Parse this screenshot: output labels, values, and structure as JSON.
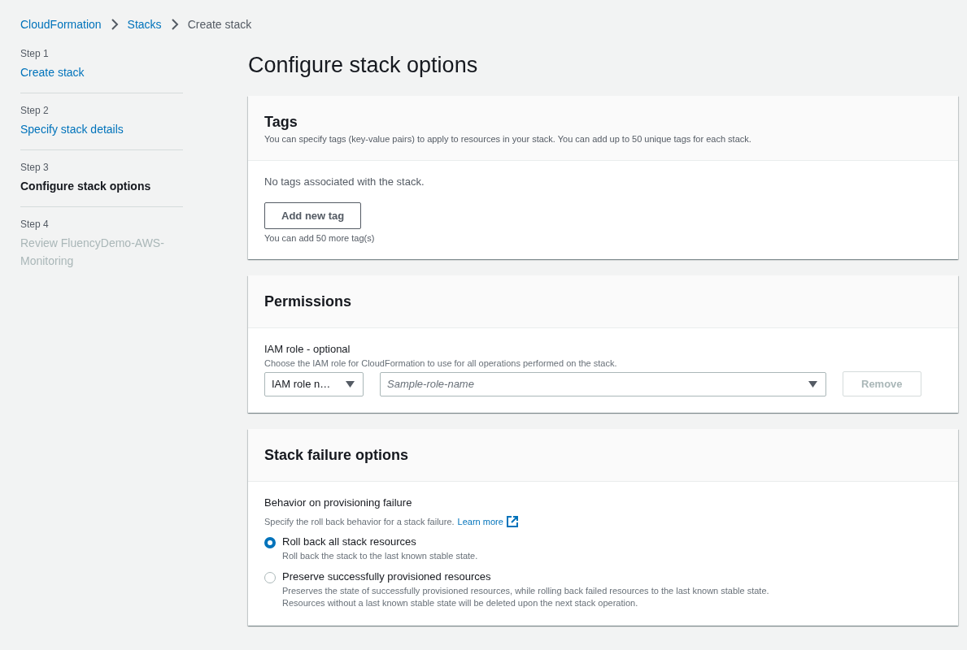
{
  "breadcrumbs": [
    {
      "label": "CloudFormation",
      "link": true
    },
    {
      "label": "Stacks",
      "link": true
    },
    {
      "label": "Create stack",
      "link": false
    }
  ],
  "steps": [
    {
      "step": "Step 1",
      "label": "Create stack",
      "kind": "done"
    },
    {
      "step": "Step 2",
      "label": "Specify stack details",
      "kind": "done"
    },
    {
      "step": "Step 3",
      "label": "Configure stack options",
      "kind": "current"
    },
    {
      "step": "Step 4",
      "label": "Review FluencyDemo-AWS-Monitoring",
      "kind": "upcoming"
    }
  ],
  "page_title": "Configure stack options",
  "tags": {
    "title": "Tags",
    "description": "You can specify tags (key-value pairs) to apply to resources in your stack. You can add up to 50 unique tags for each stack.",
    "empty_text": "No tags associated with the stack.",
    "add_button": "Add new tag",
    "hint": "You can add 50 more tag(s)"
  },
  "permissions": {
    "title": "Permissions",
    "label": "IAM role - optional",
    "description": "Choose the IAM role for CloudFormation to use for all operations performed on the stack.",
    "type_select": "IAM role n…",
    "role_select": {
      "placeholder": "Sample-role-name"
    },
    "remove_button": {
      "label": "Remove",
      "disabled": true
    }
  },
  "failure": {
    "title": "Stack failure options",
    "label": "Behavior on provisioning failure",
    "description": "Specify the roll back behavior for a stack failure.",
    "learn_more": "Learn more",
    "options": [
      {
        "label": "Roll back all stack resources",
        "description": "Roll back the stack to the last known stable state.",
        "selected": true
      },
      {
        "label": "Preserve successfully provisioned resources",
        "description": "Preserves the state of successfully provisioned resources, while rolling back failed resources to the last known stable state. Resources without a last known stable state will be deleted upon the next stack operation.",
        "selected": false
      }
    ]
  }
}
